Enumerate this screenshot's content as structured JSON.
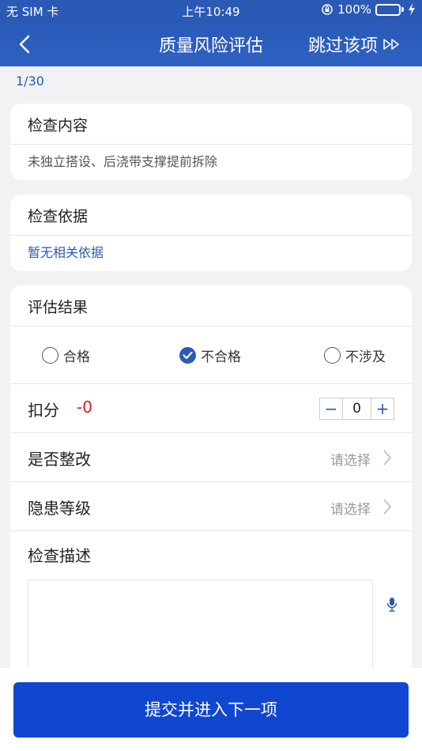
{
  "status_bar": {
    "carrier": "无 SIM 卡",
    "time": "上午10:49",
    "battery": "100%"
  },
  "nav": {
    "title": "质量风险评估",
    "skip_label": "跳过该项"
  },
  "progress": "1/30",
  "inspection_content": {
    "title": "检查内容",
    "text": "未独立搭设、后浇带支撑提前拆除"
  },
  "inspection_basis": {
    "title": "检查依据",
    "text": "暂无相关依据"
  },
  "evaluation": {
    "title": "评估结果",
    "options": [
      "合格",
      "不合格",
      "不涉及"
    ],
    "selected": "不合格",
    "deduction_label": "扣分",
    "deduction_value": "-0",
    "stepper_value": "0",
    "rectify_label": "是否整改",
    "rectify_value": "请选择",
    "hazard_label": "隐患等级",
    "hazard_value": "请选择",
    "description_label": "检查描述"
  },
  "submit_label": "提交并进入下一项",
  "colors": {
    "primary": "#2a59b6",
    "button": "#1047d0",
    "deduction": "#e02020"
  }
}
